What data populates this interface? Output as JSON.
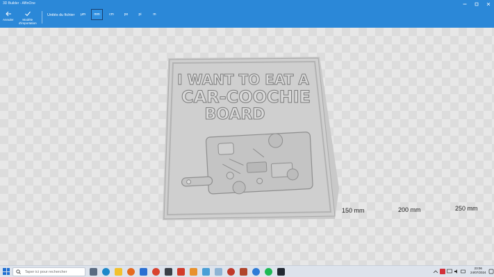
{
  "window": {
    "title": "3D Builder - AffinOne",
    "controls": [
      "minimize-icon",
      "maximize-icon",
      "close-icon"
    ]
  },
  "toolbar": {
    "back_label": "Annuler",
    "import_label_line1": "Modèle",
    "import_label_line2": "d'importation",
    "units_label": "Unités du fichier",
    "units": [
      "µm",
      "mm",
      "cm",
      "po",
      "pi",
      "m"
    ],
    "selected_unit": "mm"
  },
  "viewport": {
    "ruler_labels": [
      "150 mm",
      "200 mm",
      "250 mm"
    ],
    "board_text_line1": "I WANT TO EAT A",
    "board_text_line2": "CAR-COOCHIE",
    "board_text_line3": "BOARD"
  },
  "taskbar": {
    "search_placeholder": "Taper ici pour rechercher",
    "time": "23:06",
    "date": "24/07/2024",
    "apps": [
      "task-view-icon",
      "edge-icon",
      "file-explorer-icon",
      "firefox-icon",
      "mail-icon",
      "chrome-icon",
      "calculator-icon",
      "photos-icon",
      "app-orange-icon",
      "paint-icon",
      "3d-builder-icon",
      "settings-icon",
      "app-game-icon",
      "app-blue-icon",
      "spotify-icon",
      "taskbar-app-icon"
    ]
  }
}
